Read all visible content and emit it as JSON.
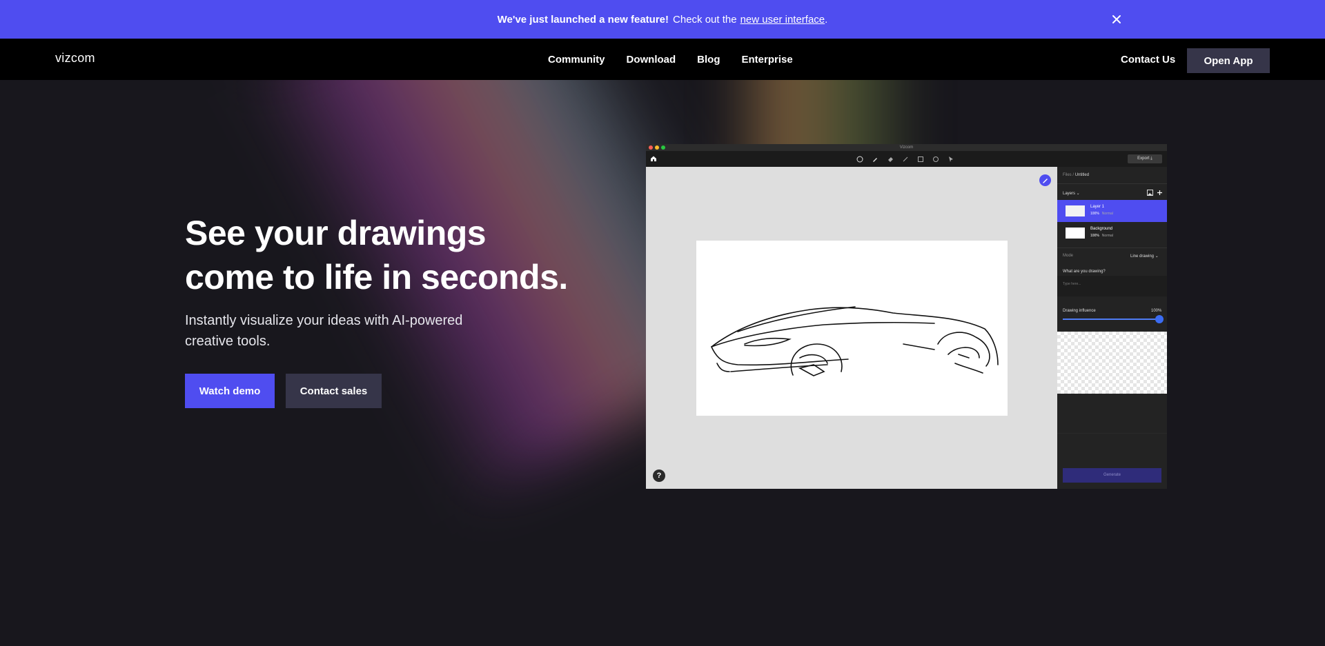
{
  "banner": {
    "bold": "We've just launched a new feature!",
    "text": "Check out the",
    "link": "new user interface",
    "period": "."
  },
  "nav": {
    "logo": "vizcom",
    "links": [
      "Community",
      "Download",
      "Blog",
      "Enterprise"
    ],
    "contact": "Contact Us",
    "open_app": "Open App"
  },
  "hero": {
    "title_line1": "See your drawings",
    "title_line2": "come to life in seconds.",
    "subtitle": "Instantly visualize your ideas with AI-powered creative tools.",
    "watch_demo": "Watch demo",
    "contact_sales": "Contact sales"
  },
  "app": {
    "window_title": "Vizcom",
    "export": "Export",
    "breadcrumb_root": "Files /",
    "breadcrumb_current": "Untitled",
    "layers_label": "Layers",
    "layers": [
      {
        "name": "Layer 1",
        "opacity": "100%",
        "blend": "Normal",
        "active": true
      },
      {
        "name": "Background",
        "opacity": "100%",
        "blend": "Normal",
        "active": false
      }
    ],
    "mode_label": "Mode",
    "mode_value": "Line drawing",
    "question": "What are you drawing?",
    "prompt_placeholder": "Type here...",
    "influence_label": "Drawing influence",
    "influence_value": "100%",
    "influence_fraction": 1.0,
    "generate": "Generate",
    "help": "?"
  },
  "colors": {
    "accent": "#4f4df0",
    "secondary_button": "#363549",
    "background": "#18171d"
  }
}
